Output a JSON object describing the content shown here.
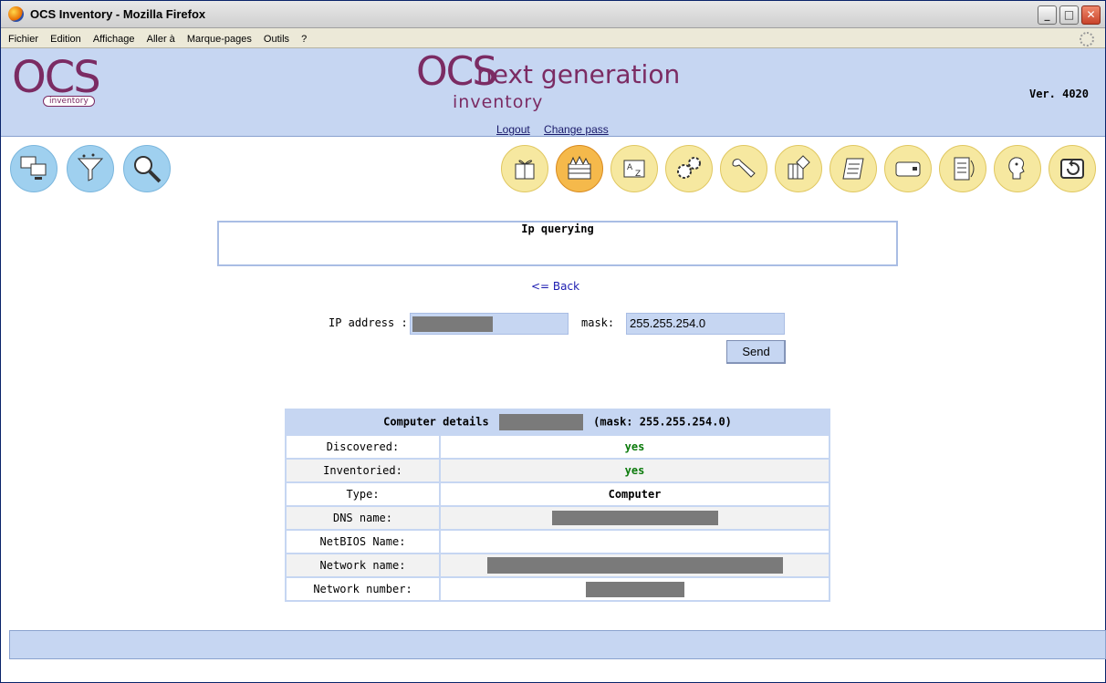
{
  "window": {
    "title": "OCS Inventory - Mozilla Firefox"
  },
  "menu": {
    "items": [
      "Fichier",
      "Edition",
      "Affichage",
      "Aller à",
      "Marque-pages",
      "Outils",
      "?"
    ]
  },
  "header": {
    "logo_left_text": "OCS",
    "logo_left_sub": "inventory",
    "logo_center_ocs": "OCS",
    "logo_center_ng": "next generation",
    "logo_center_inv": "inventory",
    "logout": "Logout",
    "change_pass": "Change pass",
    "version": "Ver. 4020"
  },
  "toolbar": {
    "left_icons": [
      "computers-icon",
      "filter-icon",
      "search-icon"
    ],
    "right_icons": [
      "gift-icon",
      "firewall-icon",
      "dictionary-icon",
      "gears-icon",
      "wrench-icon",
      "software-icon",
      "scroll-icon",
      "card-icon",
      "document-icon",
      "help-icon",
      "back-icon"
    ]
  },
  "page": {
    "title": "Ip querying",
    "back_link": "<= Back",
    "ip_label": "IP address :",
    "mask_label": "mask:",
    "mask_value": "255.255.254.0",
    "send_label": "Send"
  },
  "details": {
    "header_prefix": "Computer details",
    "header_suffix": "(mask: 255.255.254.0)",
    "rows": [
      {
        "label": "Discovered:",
        "value": "yes"
      },
      {
        "label": "Inventoried:",
        "value": "yes"
      },
      {
        "label": "Type:",
        "value": "Computer"
      },
      {
        "label": "DNS name:",
        "value": ""
      },
      {
        "label": "NetBIOS Name:",
        "value": ""
      },
      {
        "label": "Network name:",
        "value": ""
      },
      {
        "label": "Network number:",
        "value": ""
      }
    ]
  }
}
